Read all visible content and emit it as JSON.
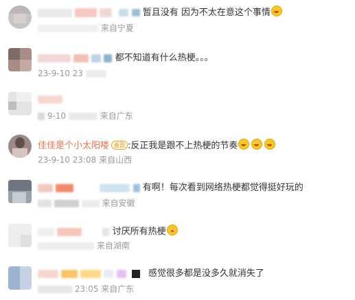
{
  "comments": [
    {
      "text": "暂且没有 因为不太在意这个事情",
      "date": "",
      "location": "来自宁夏",
      "emojis": [
        "laugh-cry-emoji"
      ]
    },
    {
      "text": "都不知道有什么热梗。。。",
      "date": "23-9-10 23",
      "location": "",
      "emojis": []
    },
    {
      "text": "",
      "date": "9-10",
      "location": "来自广东",
      "emojis": []
    },
    {
      "username": "佳佳是个小太阳喽",
      "badge": "会员",
      "text": ":反正我是跟不上热梗的节奏",
      "date": "23-9-10 23:08",
      "location": "来自山西",
      "emojis": [
        "laugh-cry-emoji",
        "laugh-cry-emoji",
        "laugh-cry-emoji"
      ]
    },
    {
      "text": "有啊！每次看到网络热梗都觉得挺好玩的",
      "date": "",
      "location": "来自安徽",
      "emojis": []
    },
    {
      "text": "讨厌所有热梗",
      "date": "",
      "location": "来自湖南",
      "emojis": [
        "kiss-emoji"
      ]
    },
    {
      "text": "感觉很多都是没多久就消失了",
      "date": "23:05",
      "location": "来自广东",
      "emojis": []
    }
  ]
}
